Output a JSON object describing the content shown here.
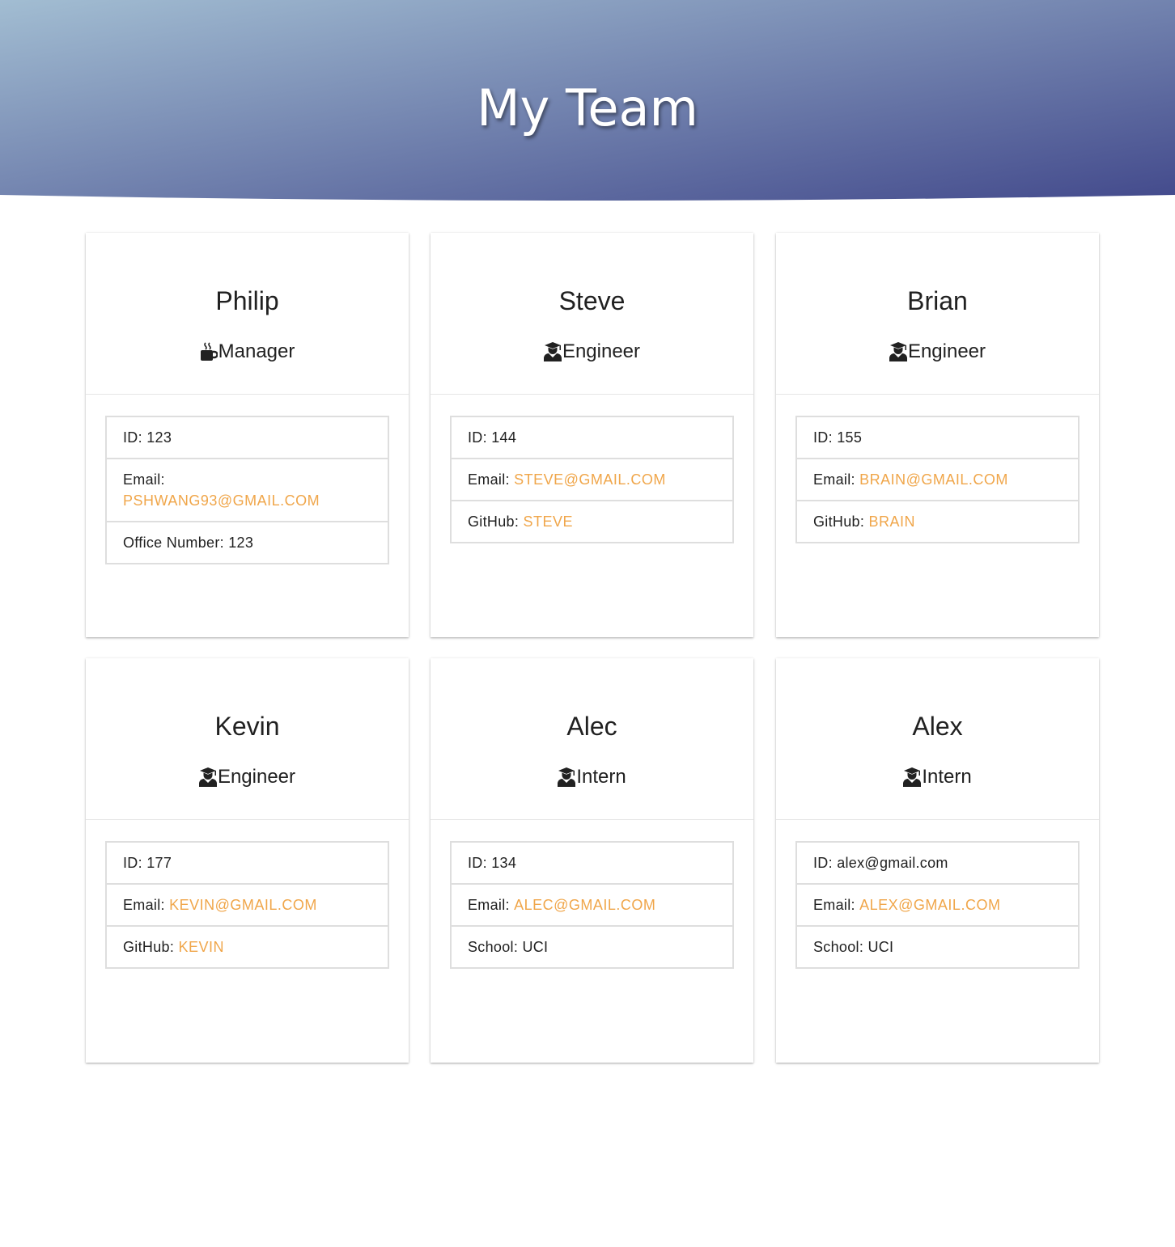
{
  "header": {
    "title": "My Team"
  },
  "colors": {
    "header_gradient_start": "#a2bdd2",
    "header_gradient_end": "#434a8c",
    "accent": "#f0a64a"
  },
  "cards": [
    {
      "name": "Philip",
      "role": "Manager",
      "role_icon": "mug-icon",
      "id_label": "ID: 123",
      "email_label": "Email:",
      "email": "pshwang93@gmail.com",
      "extra_label": "Office Number: 123",
      "extra_value": ""
    },
    {
      "name": "Steve",
      "role": "Engineer",
      "role_icon": "user-graduate-icon",
      "id_label": "ID: 144",
      "email_label": "Email:",
      "email": "steve@gmail.com",
      "extra_label": "GitHub:",
      "extra_value": "steve"
    },
    {
      "name": "Brian",
      "role": "Engineer",
      "role_icon": "user-graduate-icon",
      "id_label": "ID: 155",
      "email_label": "Email:",
      "email": "brain@gmail.com",
      "extra_label": "GitHub:",
      "extra_value": "brain"
    },
    {
      "name": "Kevin",
      "role": "Engineer",
      "role_icon": "user-graduate-icon",
      "id_label": "ID: 177",
      "email_label": "Email:",
      "email": "kevin@gmail.com",
      "extra_label": "GitHub:",
      "extra_value": "kevin"
    },
    {
      "name": "Alec",
      "role": "Intern",
      "role_icon": "user-graduate-icon",
      "id_label": "ID: 134",
      "email_label": "Email:",
      "email": "alec@gmail.com",
      "extra_label": "School: UCI",
      "extra_value": ""
    },
    {
      "name": "Alex",
      "role": "Intern",
      "role_icon": "user-graduate-icon",
      "id_label": "ID: alex@gmail.com",
      "email_label": "Email:",
      "email": "alex@gmail.com",
      "extra_label": "School: UCI",
      "extra_value": ""
    }
  ]
}
